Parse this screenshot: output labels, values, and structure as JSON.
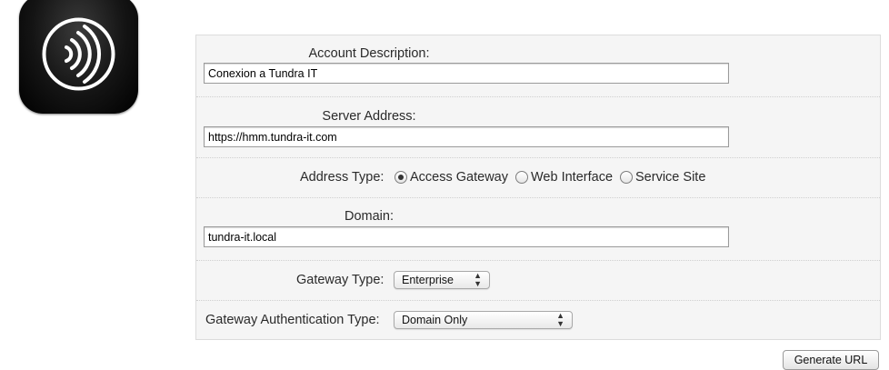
{
  "app_icon": {
    "name": "receiver-waves-icon"
  },
  "form": {
    "account_description": {
      "label": "Account Description:",
      "value": "Conexion a Tundra IT"
    },
    "server_address": {
      "label": "Server Address:",
      "value": "https://hmm.tundra-it.com"
    },
    "address_type": {
      "label": "Address Type:",
      "options": [
        {
          "label": "Access Gateway",
          "checked": true
        },
        {
          "label": "Web Interface",
          "checked": false
        },
        {
          "label": "Service Site",
          "checked": false
        }
      ]
    },
    "domain": {
      "label": "Domain:",
      "value": "tundra-it.local"
    },
    "gateway_type": {
      "label": "Gateway Type:",
      "selected": "Enterprise"
    },
    "gateway_auth_type": {
      "label": "Gateway Authentication Type:",
      "selected": "Domain Only"
    }
  },
  "actions": {
    "generate_label": "Generate URL"
  }
}
